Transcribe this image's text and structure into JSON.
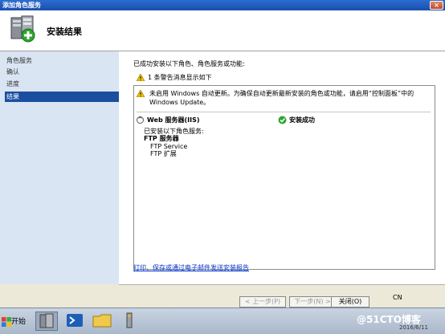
{
  "window": {
    "title": "添加角色服务",
    "close_glyph": "×"
  },
  "header": {
    "title": "安装结果"
  },
  "nav": {
    "items": [
      "角色服务",
      "确认",
      "进度",
      "结果"
    ]
  },
  "main": {
    "intro": "已成功安装以下角色、角色服务或功能:",
    "warning_count": "1 条警告消息显示如下",
    "warning_message": "未启用 Windows 自动更新。为确保自动更新最新安装的角色或功能，请启用“控制面板”中的 Windows Update。",
    "role": {
      "name": "Web 服务器(IIS)",
      "status": "安装成功"
    },
    "installed_label": "已安装以下角色服务:",
    "service_group": "FTP 服务器",
    "services": [
      "FTP Service",
      "FTP 扩展"
    ],
    "report_link": "打印、保存或通过电子邮件发送安装报告"
  },
  "buttons": {
    "prev": "< 上一步(P)",
    "next": "下一步(N) >",
    "close": "关闭(O)"
  },
  "taskbar": {
    "start": "开始",
    "lang": "CN",
    "watermark": "@51CTO博客",
    "clock": "2016/6/11"
  }
}
